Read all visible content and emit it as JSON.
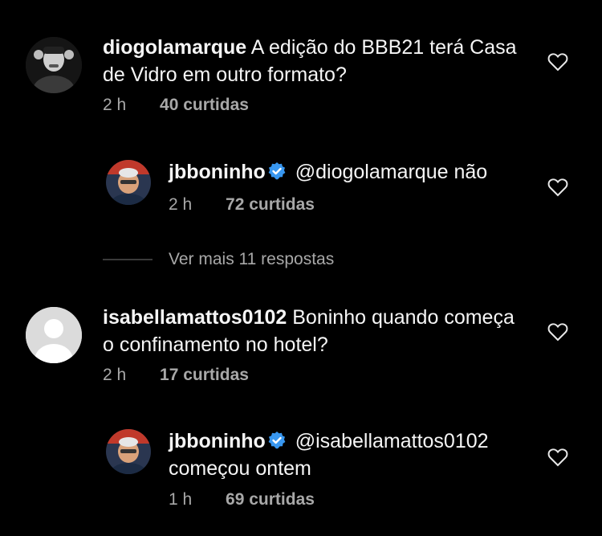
{
  "comments": [
    {
      "username": "diogolamarque",
      "text": "A edição do BBB21 terá Casa de Vidro em outro formato?",
      "time": "2 h",
      "likes": "40 curtidas",
      "avatar_icon": "profile-photo"
    },
    {
      "username": "jbboninho",
      "verified": true,
      "text": "@diogolamarque não",
      "time": "2 h",
      "likes": "72 curtidas",
      "avatar_icon": "profile-photo"
    },
    {
      "username": "isabellamattos0102",
      "text": "Boninho quando começa o confinamento no hotel?",
      "time": "2 h",
      "likes": "17 curtidas",
      "avatar_icon": "default-avatar"
    },
    {
      "username": "jbboninho",
      "verified": true,
      "text": "@isabellamattos0102 começou ontem",
      "time": "1 h",
      "likes": "69 curtidas",
      "avatar_icon": "profile-photo"
    }
  ],
  "view_more_replies": "Ver mais 11 respostas",
  "colors": {
    "background": "#000000",
    "text": "#f5f5f5",
    "muted": "#a8a8a8",
    "verified": "#3897f0"
  }
}
